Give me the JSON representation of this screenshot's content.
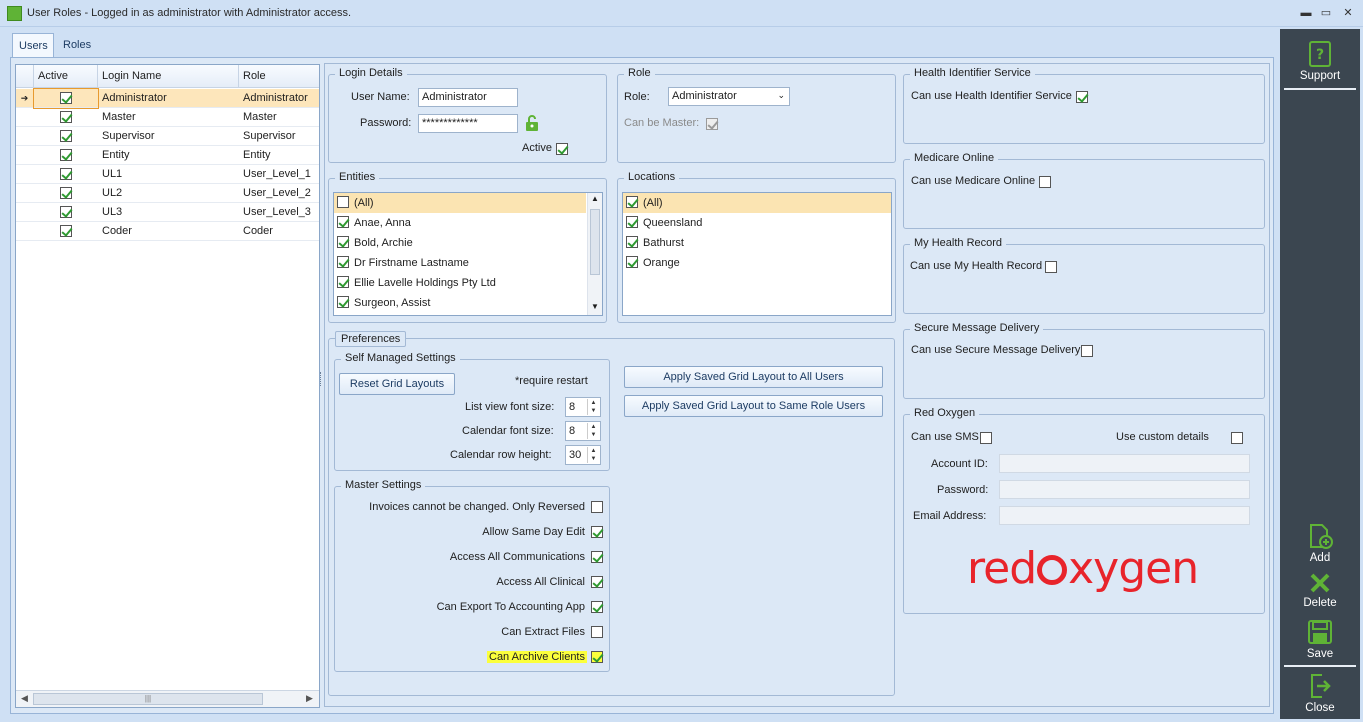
{
  "window": {
    "title": "User Roles - Logged in as administrator with Administrator access.",
    "min": "▬",
    "max": "▭",
    "close": "✕"
  },
  "tabs": [
    {
      "label": "Users"
    },
    {
      "label": "Roles"
    }
  ],
  "grid": {
    "headers": [
      "Active",
      "Login Name",
      "Role"
    ],
    "rows": [
      {
        "active": true,
        "login": "Administrator",
        "role": "Administrator",
        "selected": true
      },
      {
        "active": true,
        "login": "Master",
        "role": "Master"
      },
      {
        "active": true,
        "login": "Supervisor",
        "role": "Supervisor"
      },
      {
        "active": true,
        "login": "Entity",
        "role": "Entity"
      },
      {
        "active": true,
        "login": "UL1",
        "role": "User_Level_1"
      },
      {
        "active": true,
        "login": "UL2",
        "role": "User_Level_2"
      },
      {
        "active": true,
        "login": "UL3",
        "role": "User_Level_3"
      },
      {
        "active": true,
        "login": "Coder",
        "role": "Coder"
      }
    ],
    "scroll_thumb": "|||"
  },
  "login": {
    "title": "Login Details",
    "user_label": "User Name:",
    "user_value": "Administrator",
    "pass_label": "Password:",
    "pass_value": "*************",
    "active_label": "Active"
  },
  "role": {
    "title": "Role",
    "role_label": "Role:",
    "role_value": "Administrator",
    "master_label": "Can be Master:"
  },
  "entities": {
    "title": "Entities",
    "items": [
      {
        "label": "(All)",
        "checked": false
      },
      {
        "label": "Anae, Anna",
        "checked": true
      },
      {
        "label": "Bold, Archie",
        "checked": true
      },
      {
        "label": "Dr Firstname Lastname",
        "checked": true
      },
      {
        "label": "Ellie Lavelle Holdings Pty Ltd",
        "checked": true
      },
      {
        "label": "Surgeon, Assist",
        "checked": true
      }
    ]
  },
  "locations": {
    "title": "Locations",
    "items": [
      {
        "label": "(All)",
        "checked": true
      },
      {
        "label": "Queensland",
        "checked": true
      },
      {
        "label": "Bathurst",
        "checked": true
      },
      {
        "label": "Orange",
        "checked": true
      }
    ]
  },
  "preferences": {
    "title": "Preferences",
    "self_title": "Self Managed Settings",
    "reset": "Reset Grid Layouts",
    "restart": "*require restart",
    "list_font_label": "List view font size:",
    "list_font": "8",
    "cal_font_label": "Calendar font size:",
    "cal_font": "8",
    "cal_row_label": "Calendar row height:",
    "cal_row": "30",
    "apply_all": "Apply Saved Grid Layout to All Users",
    "apply_role": "Apply Saved Grid Layout to Same Role Users"
  },
  "master": {
    "title": "Master Settings",
    "items": [
      {
        "label": "Invoices cannot be changed. Only Reversed",
        "checked": false
      },
      {
        "label": "Allow Same Day Edit",
        "checked": true
      },
      {
        "label": "Access All Communications",
        "checked": true
      },
      {
        "label": "Access All Clinical",
        "checked": true
      },
      {
        "label": "Can Export To Accounting App",
        "checked": true
      },
      {
        "label": "Can Extract Files",
        "checked": false
      },
      {
        "label": "Can Archive Clients",
        "checked": true
      }
    ]
  },
  "his": {
    "title": "Health Identifier Service",
    "label": "Can use Health Identifier Service"
  },
  "medicare": {
    "title": "Medicare Online",
    "label": "Can use Medicare Online"
  },
  "mhr": {
    "title": "My Health Record",
    "label": "Can use My Health Record"
  },
  "smd": {
    "title": "Secure Message Delivery",
    "label": "Can use Secure Message Delivery"
  },
  "redox": {
    "title": "Red Oxygen",
    "sms": "Can use SMS",
    "custom": "Use custom details",
    "account": "Account ID:",
    "password": "Password:",
    "email": "Email Address:",
    "logo_a": "red",
    "logo_b": "xygen"
  },
  "sidebar": {
    "support": "Support",
    "add": "Add",
    "delete": "Delete",
    "save": "Save",
    "close": "Close"
  },
  "colors": {
    "accent_green": "#5fb336",
    "sidebar": "#3b4650",
    "selection": "#fbe4b2",
    "logo_red": "#e8242b",
    "highlight": "#fbff3c"
  }
}
